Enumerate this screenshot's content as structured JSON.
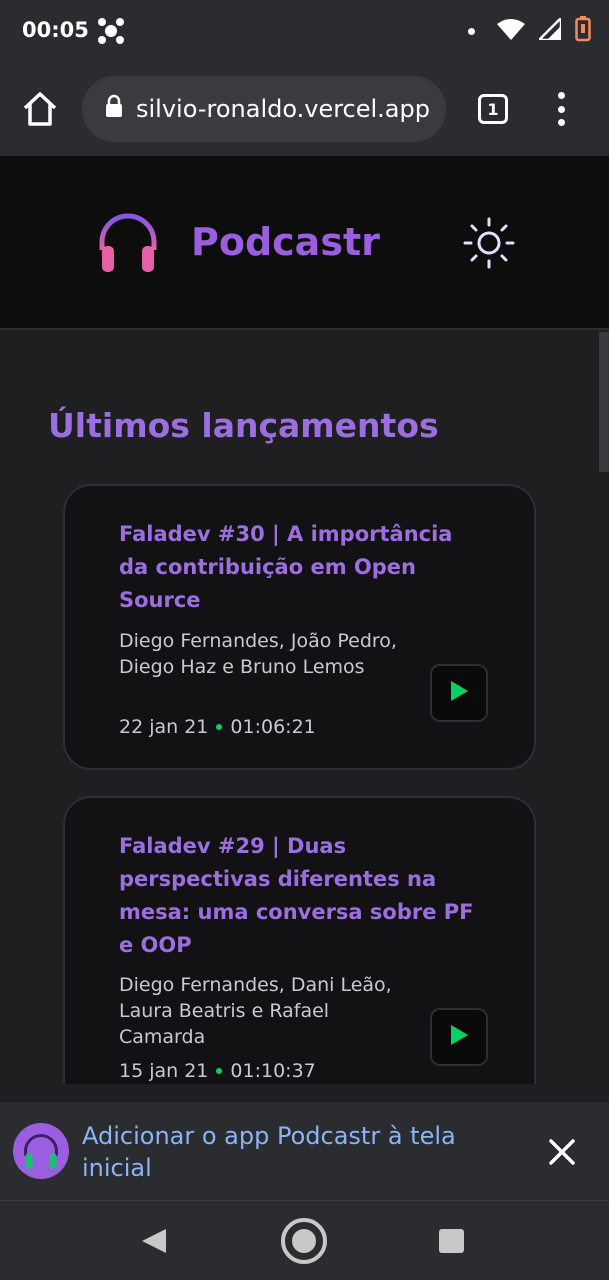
{
  "status_bar": {
    "time": "00:05"
  },
  "browser": {
    "url": "silvio-ronaldo.vercel.app",
    "tab_count": "1"
  },
  "app": {
    "name": "Podcastr"
  },
  "main": {
    "section_title": "Últimos lançamentos",
    "episodes": [
      {
        "title": "Faladev #30 | A importância da contribuição em Open Source",
        "authors": "Diego Fernandes, João Pedro, Diego Haz e Bruno Lemos",
        "date": "22 jan 21",
        "duration": "01:06:21"
      },
      {
        "title": "Faladev #29 | Duas perspectivas diferentes na mesa: uma conversa sobre PF e OOP",
        "authors": "Diego Fernandes, Dani Leão, Laura Beatris e Rafael Camarda",
        "date": "15 jan 21",
        "duration": "01:10:37"
      }
    ]
  },
  "install_banner": {
    "text": "Adicionar o app Podcastr à tela inicial"
  },
  "colors": {
    "accent": "#9c5ee0",
    "play": "#04d361",
    "link": "#8ab4f8"
  },
  "icons": [
    "wifi-icon",
    "signal-icon",
    "battery-icon",
    "home-icon",
    "lock-icon",
    "headphones-icon",
    "sun-icon",
    "play-icon",
    "close-icon",
    "back-icon",
    "home-circle-icon",
    "recents-icon"
  ]
}
